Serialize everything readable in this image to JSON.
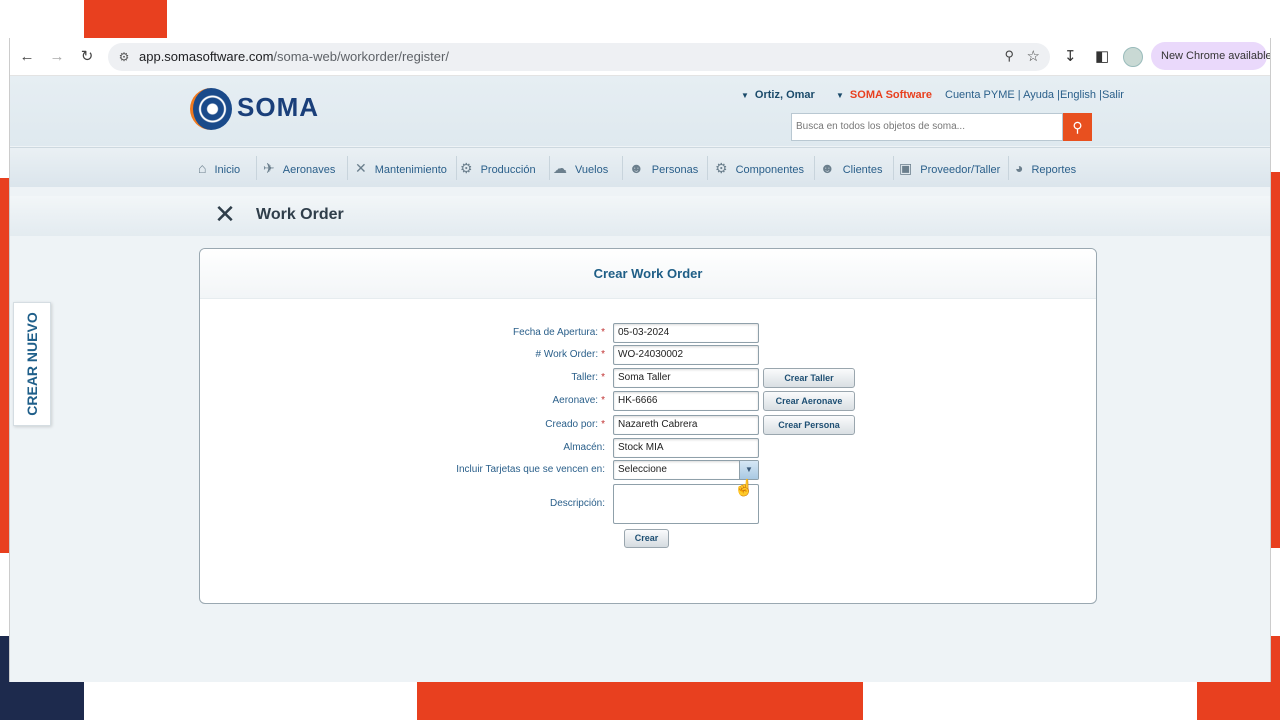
{
  "browser": {
    "url_host": "app.somasoftware.com",
    "url_path": "/soma-web/workorder/register/",
    "new_chrome_label": "New Chrome available"
  },
  "header": {
    "logo_text": "SOMA",
    "user_name": "Ortiz, Omar",
    "company": "SOMA Software",
    "account_links": "Cuenta PYME | Ayuda |English |Salir",
    "search_placeholder": "Busca en todos los objetos de soma..."
  },
  "nav": {
    "items": [
      {
        "label": "Inicio",
        "icon": "home-icon"
      },
      {
        "label": "Aeronaves",
        "icon": "airplane-icon"
      },
      {
        "label": "Mantenimiento",
        "icon": "tools-icon"
      },
      {
        "label": "Producción",
        "icon": "production-icon"
      },
      {
        "label": "Vuelos",
        "icon": "flights-icon"
      },
      {
        "label": "Personas",
        "icon": "people-icon"
      },
      {
        "label": "Componentes",
        "icon": "gear-icon"
      },
      {
        "label": "Clientes",
        "icon": "client-icon"
      },
      {
        "label": "Proveedor/Taller",
        "icon": "factory-icon"
      },
      {
        "label": "Reportes",
        "icon": "pie-chart-icon"
      }
    ]
  },
  "page": {
    "title": "Work Order",
    "side_tab": "CREAR NUEVO"
  },
  "form": {
    "title": "Crear Work Order",
    "fields": {
      "fecha_apertura": {
        "label": "Fecha de Apertura:",
        "value": "05-03-2024",
        "required": "*"
      },
      "work_order": {
        "label": "# Work Order:",
        "value": "WO-24030002",
        "required": "*"
      },
      "taller": {
        "label": "Taller:",
        "value": "Soma Taller",
        "required": "*",
        "button": "Crear Taller"
      },
      "aeronave": {
        "label": "Aeronave:",
        "value": "HK-6666",
        "required": "*",
        "button": "Crear Aeronave"
      },
      "creado_por": {
        "label": "Creado por:",
        "value": "Nazareth Cabrera",
        "required": "*",
        "button": "Crear Persona"
      },
      "almacen": {
        "label": "Almacén:",
        "value": "Stock MIA"
      },
      "tarjetas": {
        "label": "Incluir Tarjetas que se vencen en:",
        "value": "Seleccione"
      },
      "descripcion": {
        "label": "Descripción:",
        "value": ""
      }
    },
    "submit_label": "Crear"
  },
  "colors": {
    "accent_orange": "#e8501f",
    "link_blue": "#2a5f8a",
    "title_blue": "#1e5e86"
  }
}
